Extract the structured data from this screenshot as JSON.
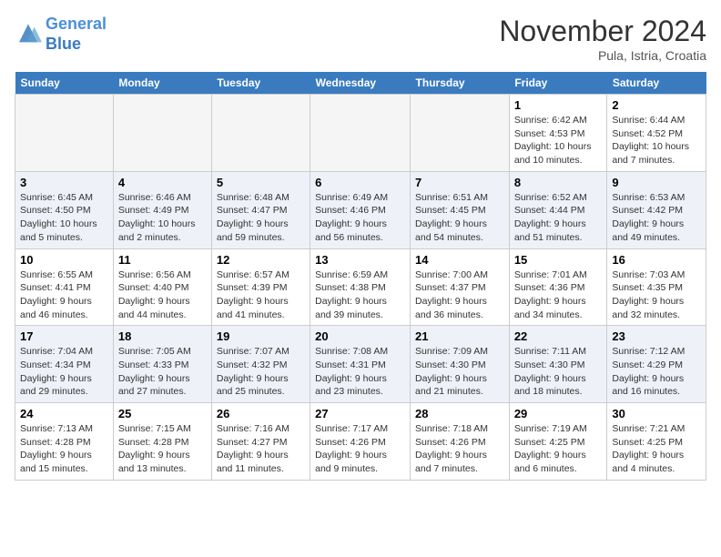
{
  "header": {
    "logo_line1": "General",
    "logo_line2": "Blue",
    "month_title": "November 2024",
    "location": "Pula, Istria, Croatia"
  },
  "weekdays": [
    "Sunday",
    "Monday",
    "Tuesday",
    "Wednesday",
    "Thursday",
    "Friday",
    "Saturday"
  ],
  "weeks": [
    [
      {
        "day": "",
        "info": ""
      },
      {
        "day": "",
        "info": ""
      },
      {
        "day": "",
        "info": ""
      },
      {
        "day": "",
        "info": ""
      },
      {
        "day": "",
        "info": ""
      },
      {
        "day": "1",
        "info": "Sunrise: 6:42 AM\nSunset: 4:53 PM\nDaylight: 10 hours\nand 10 minutes."
      },
      {
        "day": "2",
        "info": "Sunrise: 6:44 AM\nSunset: 4:52 PM\nDaylight: 10 hours\nand 7 minutes."
      }
    ],
    [
      {
        "day": "3",
        "info": "Sunrise: 6:45 AM\nSunset: 4:50 PM\nDaylight: 10 hours\nand 5 minutes."
      },
      {
        "day": "4",
        "info": "Sunrise: 6:46 AM\nSunset: 4:49 PM\nDaylight: 10 hours\nand 2 minutes."
      },
      {
        "day": "5",
        "info": "Sunrise: 6:48 AM\nSunset: 4:47 PM\nDaylight: 9 hours\nand 59 minutes."
      },
      {
        "day": "6",
        "info": "Sunrise: 6:49 AM\nSunset: 4:46 PM\nDaylight: 9 hours\nand 56 minutes."
      },
      {
        "day": "7",
        "info": "Sunrise: 6:51 AM\nSunset: 4:45 PM\nDaylight: 9 hours\nand 54 minutes."
      },
      {
        "day": "8",
        "info": "Sunrise: 6:52 AM\nSunset: 4:44 PM\nDaylight: 9 hours\nand 51 minutes."
      },
      {
        "day": "9",
        "info": "Sunrise: 6:53 AM\nSunset: 4:42 PM\nDaylight: 9 hours\nand 49 minutes."
      }
    ],
    [
      {
        "day": "10",
        "info": "Sunrise: 6:55 AM\nSunset: 4:41 PM\nDaylight: 9 hours\nand 46 minutes."
      },
      {
        "day": "11",
        "info": "Sunrise: 6:56 AM\nSunset: 4:40 PM\nDaylight: 9 hours\nand 44 minutes."
      },
      {
        "day": "12",
        "info": "Sunrise: 6:57 AM\nSunset: 4:39 PM\nDaylight: 9 hours\nand 41 minutes."
      },
      {
        "day": "13",
        "info": "Sunrise: 6:59 AM\nSunset: 4:38 PM\nDaylight: 9 hours\nand 39 minutes."
      },
      {
        "day": "14",
        "info": "Sunrise: 7:00 AM\nSunset: 4:37 PM\nDaylight: 9 hours\nand 36 minutes."
      },
      {
        "day": "15",
        "info": "Sunrise: 7:01 AM\nSunset: 4:36 PM\nDaylight: 9 hours\nand 34 minutes."
      },
      {
        "day": "16",
        "info": "Sunrise: 7:03 AM\nSunset: 4:35 PM\nDaylight: 9 hours\nand 32 minutes."
      }
    ],
    [
      {
        "day": "17",
        "info": "Sunrise: 7:04 AM\nSunset: 4:34 PM\nDaylight: 9 hours\nand 29 minutes."
      },
      {
        "day": "18",
        "info": "Sunrise: 7:05 AM\nSunset: 4:33 PM\nDaylight: 9 hours\nand 27 minutes."
      },
      {
        "day": "19",
        "info": "Sunrise: 7:07 AM\nSunset: 4:32 PM\nDaylight: 9 hours\nand 25 minutes."
      },
      {
        "day": "20",
        "info": "Sunrise: 7:08 AM\nSunset: 4:31 PM\nDaylight: 9 hours\nand 23 minutes."
      },
      {
        "day": "21",
        "info": "Sunrise: 7:09 AM\nSunset: 4:30 PM\nDaylight: 9 hours\nand 21 minutes."
      },
      {
        "day": "22",
        "info": "Sunrise: 7:11 AM\nSunset: 4:30 PM\nDaylight: 9 hours\nand 18 minutes."
      },
      {
        "day": "23",
        "info": "Sunrise: 7:12 AM\nSunset: 4:29 PM\nDaylight: 9 hours\nand 16 minutes."
      }
    ],
    [
      {
        "day": "24",
        "info": "Sunrise: 7:13 AM\nSunset: 4:28 PM\nDaylight: 9 hours\nand 15 minutes."
      },
      {
        "day": "25",
        "info": "Sunrise: 7:15 AM\nSunset: 4:28 PM\nDaylight: 9 hours\nand 13 minutes."
      },
      {
        "day": "26",
        "info": "Sunrise: 7:16 AM\nSunset: 4:27 PM\nDaylight: 9 hours\nand 11 minutes."
      },
      {
        "day": "27",
        "info": "Sunrise: 7:17 AM\nSunset: 4:26 PM\nDaylight: 9 hours\nand 9 minutes."
      },
      {
        "day": "28",
        "info": "Sunrise: 7:18 AM\nSunset: 4:26 PM\nDaylight: 9 hours\nand 7 minutes."
      },
      {
        "day": "29",
        "info": "Sunrise: 7:19 AM\nSunset: 4:25 PM\nDaylight: 9 hours\nand 6 minutes."
      },
      {
        "day": "30",
        "info": "Sunrise: 7:21 AM\nSunset: 4:25 PM\nDaylight: 9 hours\nand 4 minutes."
      }
    ]
  ]
}
